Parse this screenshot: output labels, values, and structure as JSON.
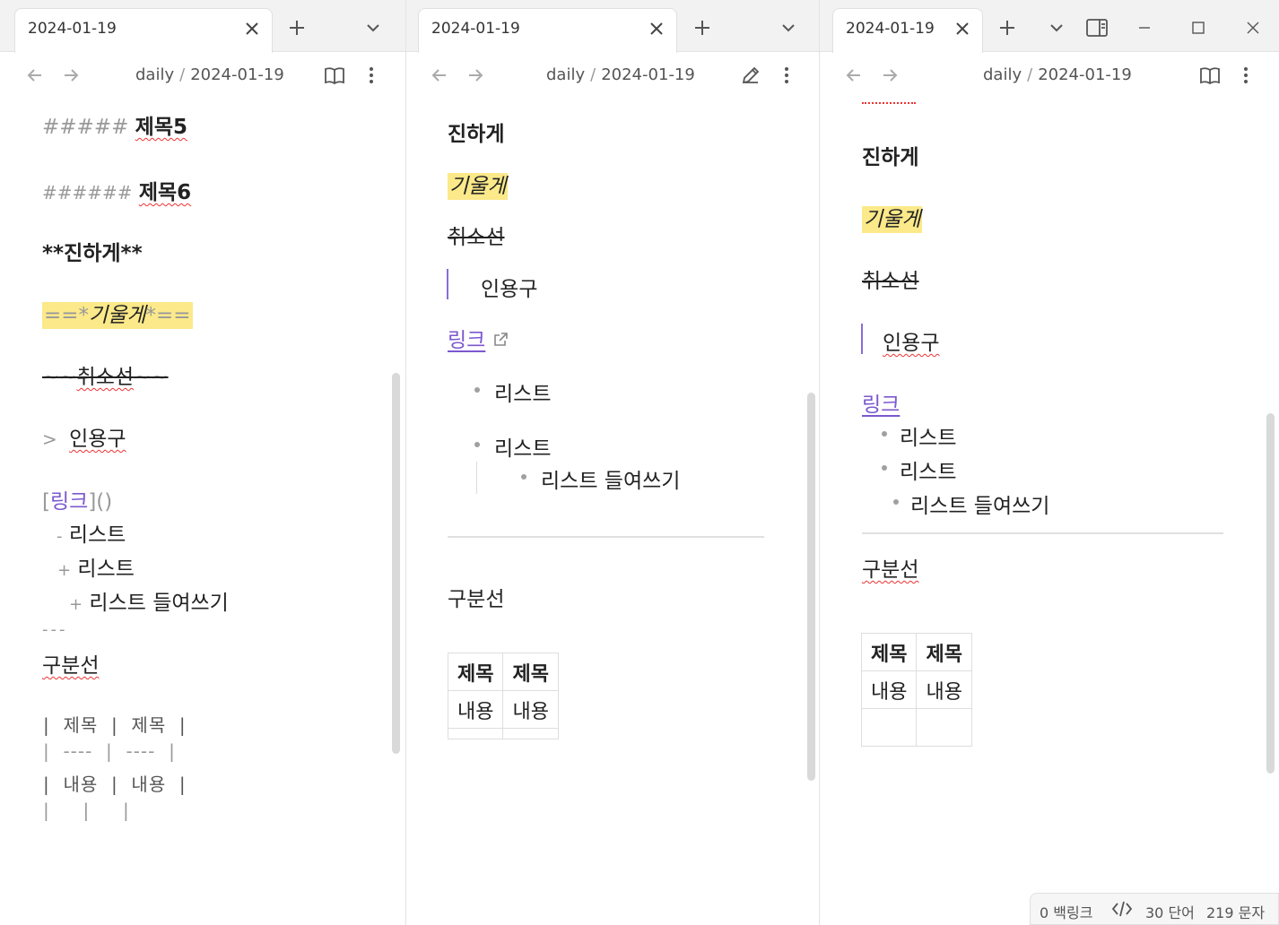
{
  "tab_title": "2024-01-19",
  "breadcrumb": {
    "folder": "daily",
    "sep": "/",
    "file": "2024-01-19"
  },
  "source": {
    "h5_marks": "#####",
    "h5_text": "제목5",
    "h6_marks": "######",
    "h6_text": "제목6",
    "bold_open": "**",
    "bold_text": "진하게",
    "bold_close": "**",
    "hl_open": "==*",
    "hl_text": "기울게",
    "hl_close": "*==",
    "strike_open": "~~",
    "strike_text": "취소선",
    "strike_close": "~~",
    "quote_mark": ">",
    "quote_text": "인용구",
    "link_open": "[",
    "link_text": "링크",
    "link_close": "]()",
    "list1_mark": "-",
    "list1_text": "리스트",
    "list2_mark": "+",
    "list2_text": "리스트",
    "list3_mark": "+",
    "list3_text": "리스트 들여쓰기",
    "hr_marks": "---",
    "divider_text": "구분선",
    "table_rows": [
      "|  제목  |  제목  |",
      "|  ----  |  ----  |",
      "|  내용  |  내용  |",
      "|     |     |"
    ]
  },
  "preview": {
    "bold_text": "진하게",
    "italic_text": "기울게",
    "strike_text": "취소선",
    "quote_text": "인용구",
    "link_text": "링크",
    "list_items": [
      "리스트",
      "리스트",
      "리스트 들여쓰기"
    ],
    "divider_text": "구분선",
    "table_headers": [
      "제목",
      "제목"
    ],
    "table_cells": [
      "내용",
      "내용"
    ]
  },
  "status": {
    "backlinks": "0 백링크",
    "words": "30 단어",
    "chars": "219 문자"
  }
}
